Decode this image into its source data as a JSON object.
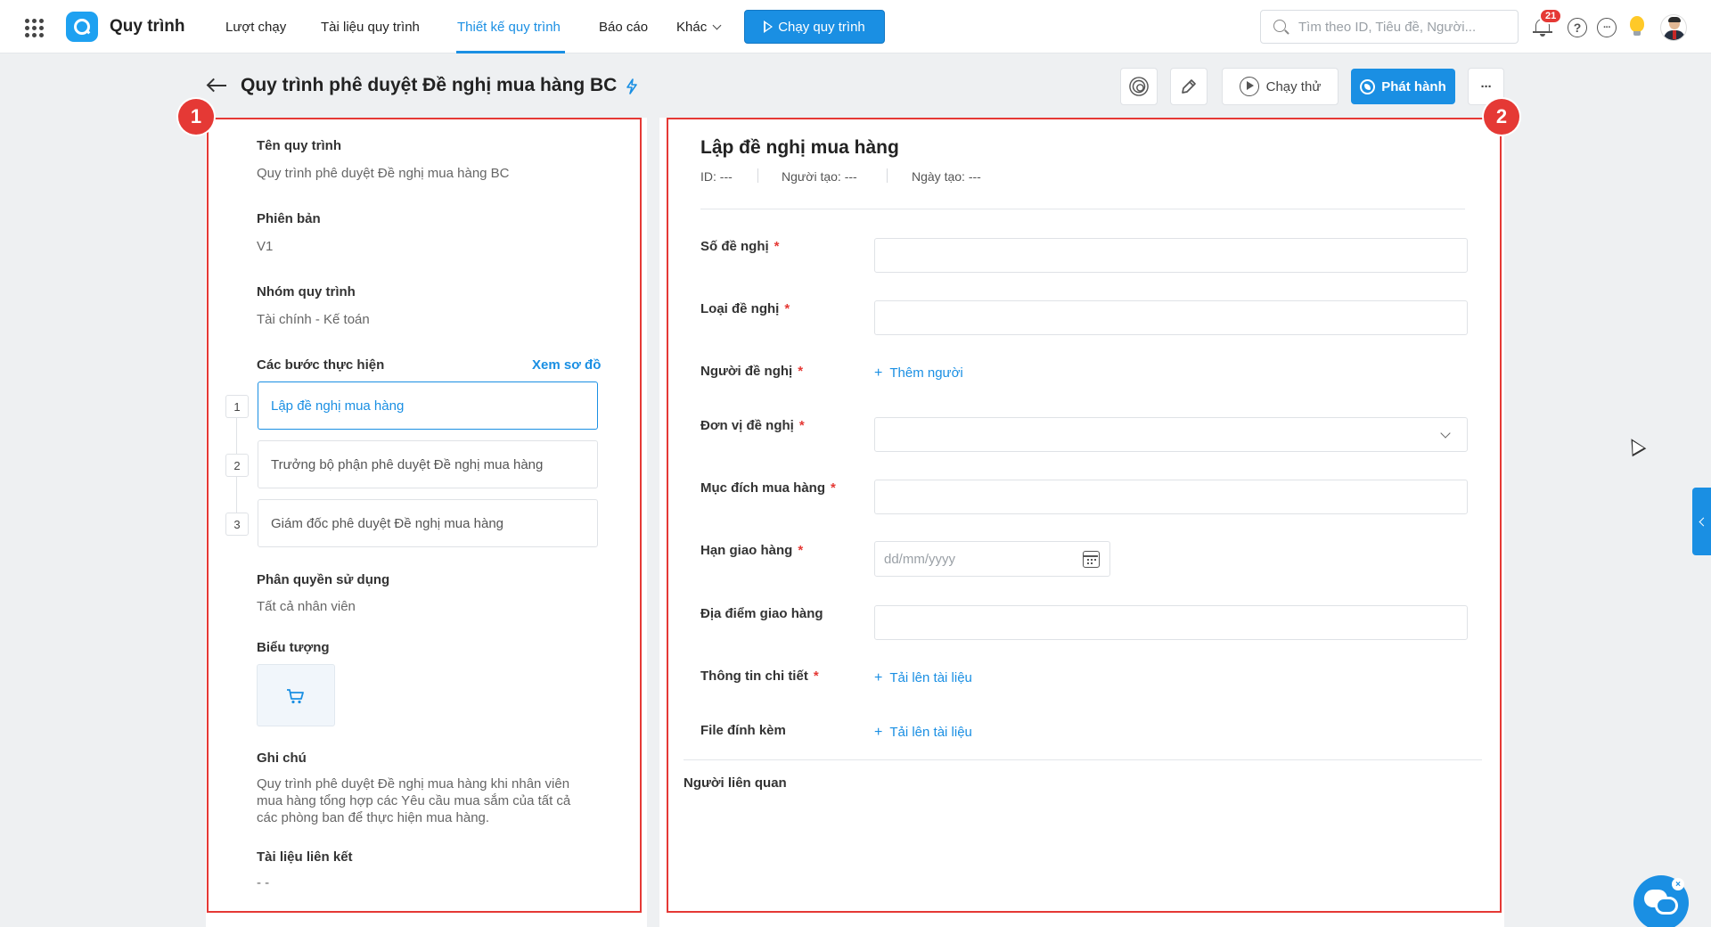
{
  "header": {
    "app_title": "Quy trình",
    "nav": [
      "Lượt chạy",
      "Tài liệu quy trình",
      "Thiết kế quy trình",
      "Báo cáo",
      "Khác"
    ],
    "run_button": "Chạy quy trình",
    "search_placeholder": "Tìm theo ID, Tiêu đề, Người...",
    "notification_count": "21",
    "help_icon": "?",
    "more_icon": "···"
  },
  "page": {
    "title": "Quy trình phê duyệt Đề nghị mua hàng BC",
    "test_button": "Chạy thử",
    "publish_button": "Phát hành",
    "more_button": "···"
  },
  "annotations": {
    "left": "1",
    "right": "2"
  },
  "left_panel": {
    "name_label": "Tên quy trình",
    "name_value": "Quy trình phê duyệt Đề nghị mua hàng BC",
    "version_label": "Phiên bản",
    "version_value": "V1",
    "group_label": "Nhóm quy trình",
    "group_value": "Tài chính - Kế toán",
    "steps_label": "Các bước thực hiện",
    "view_diagram": "Xem sơ đồ",
    "steps": [
      {
        "num": "1",
        "label": "Lập đề nghị mua hàng"
      },
      {
        "num": "2",
        "label": "Trưởng bộ phận phê duyệt Đề nghị mua hàng"
      },
      {
        "num": "3",
        "label": "Giám đốc phê duyệt Đề nghị mua hàng"
      }
    ],
    "permission_label": "Phân quyền sử dụng",
    "permission_value": "Tất cả nhân viên",
    "icon_label": "Biểu tượng",
    "note_label": "Ghi chú",
    "note_lines": [
      "Quy trình phê duyệt Đề nghị mua hàng khi nhân viên",
      "mua hàng tổng hợp các Yêu cầu mua sắm của tất cả",
      "các phòng ban để thực hiện mua hàng."
    ],
    "linked_docs_label": "Tài liệu liên kết",
    "linked_docs_value": "- -"
  },
  "form": {
    "title": "Lập đề nghị mua hàng",
    "meta": {
      "id": "ID:  ---",
      "creator": "Người tạo:  ---",
      "created": "Ngày tạo:  ---"
    },
    "required_mark": "*",
    "fields": {
      "so_de_nghi": "Số đề nghị",
      "loai_de_nghi": "Loại đề nghị",
      "nguoi_de_nghi": "Người đề nghị",
      "don_vi": "Đơn vị đề nghị",
      "muc_dich": "Mục đích mua hàng",
      "han_giao": "Hạn giao hàng",
      "dia_diem": "Địa điểm giao hàng",
      "thong_tin": "Thông tin chi tiết",
      "file": "File đính kèm"
    },
    "add_person": "Thêm người",
    "upload": "Tải lên tài liệu",
    "plus": "+",
    "date_placeholder": "dd/mm/yyyy",
    "related_people": "Người liên quan"
  },
  "colors": {
    "accent": "#1a8fe3",
    "annotation": "#e53935"
  }
}
